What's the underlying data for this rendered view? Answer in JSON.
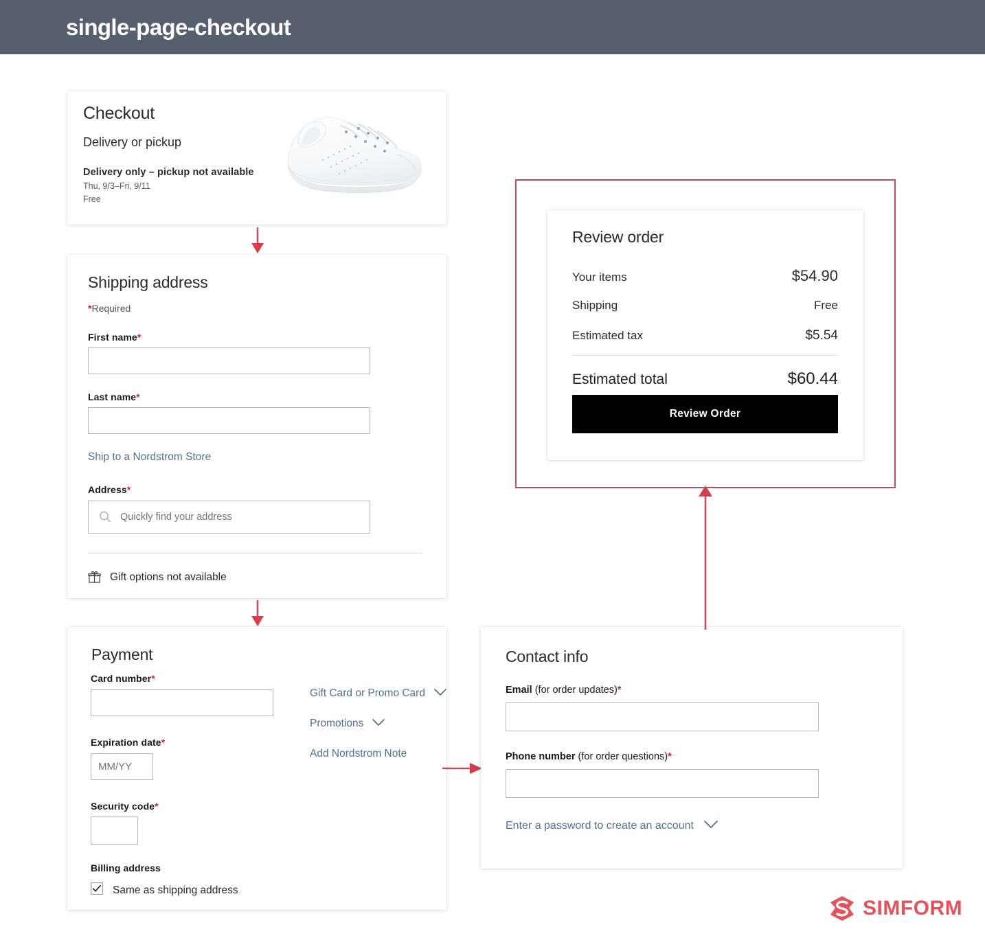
{
  "window": {
    "title": "single-page-checkout",
    "header_bg": "#565f6e"
  },
  "colors": {
    "accent_red": "#b9525f",
    "arrow_red": "#c9454e",
    "link_blue": "#53718d",
    "required_asterisk": "#c0264f",
    "button_bg": "#000000",
    "logo_red": "#e4535c"
  },
  "checkout_card": {
    "heading": "Checkout",
    "subheading": "Delivery or pickup",
    "note": "Delivery only – pickup not available",
    "dates": "Thu, 9/3–Fri, 9/11",
    "price": "Free",
    "product_image_alt": "white-sneaker"
  },
  "shipping_card": {
    "heading": "Shipping address",
    "required_note_asterisk": "*",
    "required_note": "Required",
    "first_name": {
      "label": "First name",
      "required_mark": "*",
      "value": "",
      "placeholder": ""
    },
    "last_name": {
      "label": "Last name",
      "required_mark": "*",
      "value": "",
      "placeholder": ""
    },
    "store_link": "Ship to a Nordstrom Store",
    "address": {
      "label": "Address",
      "required_mark": "*",
      "value": "",
      "placeholder": "Quickly find your address"
    },
    "gift_options": "Gift options not available"
  },
  "payment_card": {
    "heading": "Payment",
    "card_number": {
      "label": "Card number",
      "required_mark": "*",
      "value": "",
      "placeholder": ""
    },
    "expiration": {
      "label": "Expiration date",
      "required_mark": "*",
      "value": "",
      "placeholder": "MM/YY"
    },
    "security_code": {
      "label": "Security code",
      "required_mark": "*",
      "value": "",
      "placeholder": ""
    },
    "billing_heading": "Billing address",
    "billing_checkbox_label": "Same as shipping address",
    "billing_checkbox_checked": true,
    "links": [
      {
        "label": "Gift Card or Promo Card",
        "has_chevron": true
      },
      {
        "label": "Promotions",
        "has_chevron": true
      },
      {
        "label": "Add Nordstrom Note",
        "has_chevron": false
      }
    ]
  },
  "contact_card": {
    "heading": "Contact info",
    "email": {
      "label_bold": "Email",
      "label_rest": " (for order updates)",
      "required_mark": "*",
      "value": "",
      "placeholder": ""
    },
    "phone": {
      "label_bold": "Phone number",
      "label_rest": " (for order questions)",
      "required_mark": "*",
      "value": "",
      "placeholder": ""
    },
    "password_link": "Enter a password to create an account"
  },
  "review_card": {
    "heading": "Review order",
    "rows": [
      {
        "label": "Your items",
        "value": "$54.90"
      },
      {
        "label": "Shipping",
        "value": "Free"
      },
      {
        "label": "Estimated tax",
        "value": "$5.54"
      }
    ],
    "total_label": "Estimated total",
    "total_value": "$60.44",
    "button_label": "Review Order"
  },
  "branding": {
    "name": "SIMFORM"
  }
}
